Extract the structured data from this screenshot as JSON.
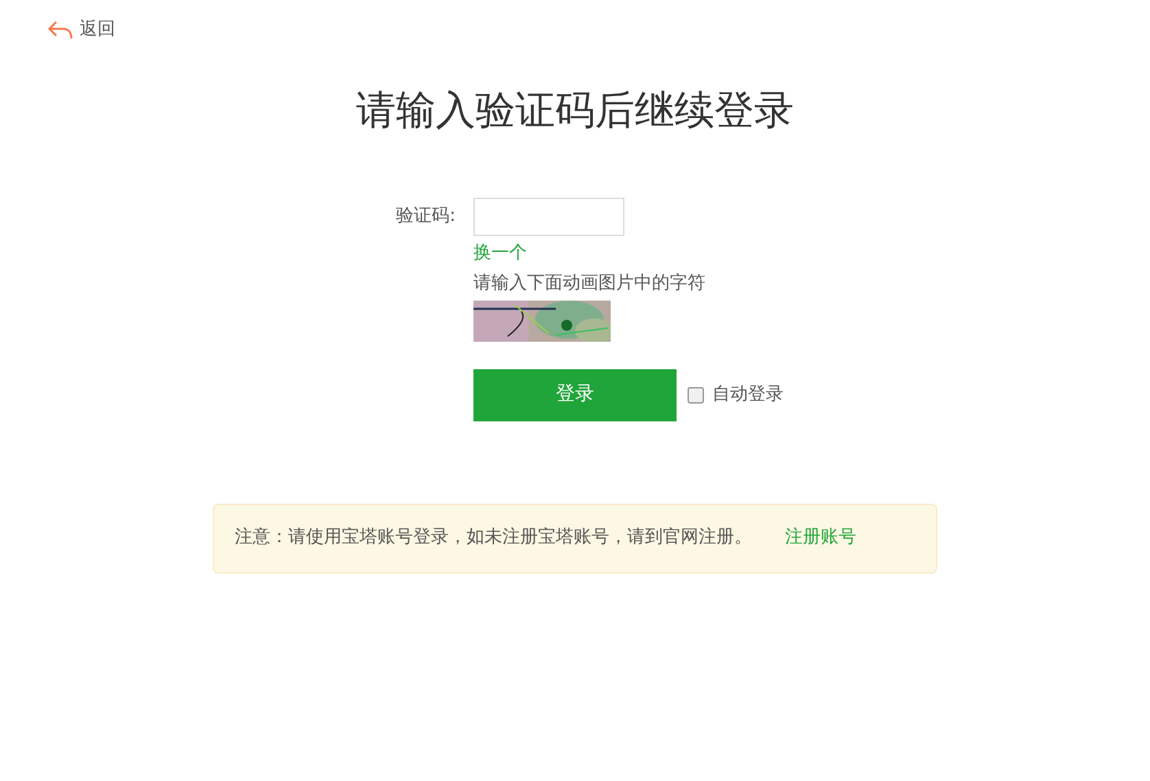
{
  "back_link": {
    "label": "返回"
  },
  "title": "请输入验证码后继续登录",
  "captcha_field": {
    "label": "验证码:"
  },
  "refresh_link": "换一个",
  "captcha_hint": "请输入下面动画图片中的字符",
  "login_button": "登录",
  "auto_login": {
    "label": "自动登录",
    "checked": false
  },
  "notice": {
    "text": "注意：请使用宝塔账号登录，如未注册宝塔账号，请到官网注册。",
    "link": "注册账号"
  }
}
